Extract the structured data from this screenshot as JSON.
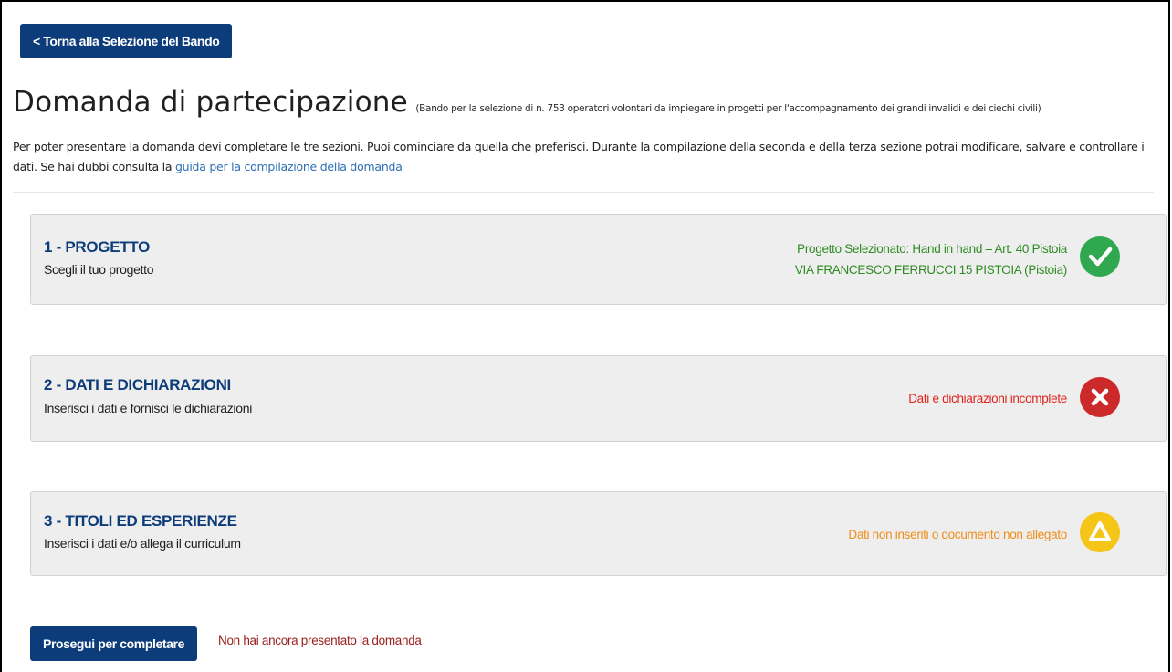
{
  "back_button": {
    "label": "< Torna alla Selezione del Bando"
  },
  "header": {
    "title": "Domanda di partecipazione",
    "subtitle": "(Bando per la selezione di n. 753 operatori volontari da impiegare in progetti per l'accompagnamento dei grandi invalidi e dei ciechi civili)"
  },
  "intro": {
    "text": "Per poter presentare la domanda devi completare le tre sezioni. Puoi cominciare da quella che preferisci. Durante la compilazione della seconda e della terza sezione potrai modificare, salvare e controllare i dati. Se hai dubbi consulta la ",
    "link_label": "guida per la compilazione della domanda"
  },
  "sections": [
    {
      "title": "1 - PROGETTO",
      "subtitle": "Scegli il tuo progetto",
      "status_line1": "Progetto Selezionato: Hand in hand – Art. 40 Pistoia",
      "status_line2": "VIA FRANCESCO FERRUCCI 15 PISTOIA (Pistoia)",
      "status_color": "#2e8b22",
      "icon": "check-circle-icon",
      "icon_color": "#2fa84f"
    },
    {
      "title": "2 - DATI E DICHIARAZIONI",
      "subtitle": "Inserisci i dati e fornisci le dichiarazioni",
      "status_line1": "Dati e dichiarazioni incomplete",
      "status_color": "#e0241b",
      "icon": "x-circle-icon",
      "icon_color": "#cc2a2a"
    },
    {
      "title": "3 - TITOLI ED ESPERIENZE",
      "subtitle": "Inserisci i dati e/o allega il curriculum",
      "status_line1": "Dati non inseriti o documento non allegato",
      "status_color": "#f08c18",
      "icon": "warning-triangle-circle-icon",
      "icon_color": "#f5c518"
    }
  ],
  "footer": {
    "proceed_label": "Prosegui per completare",
    "status_text": "Non hai ancora presentato la domanda"
  }
}
